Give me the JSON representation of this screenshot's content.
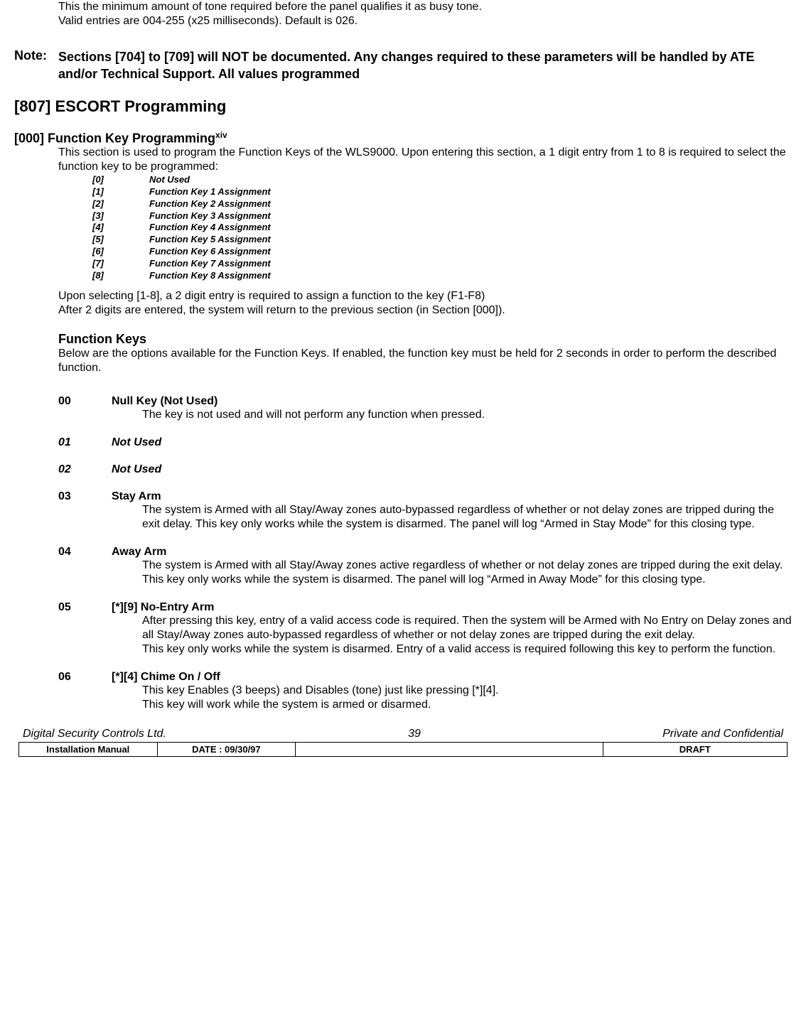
{
  "top": {
    "line1": "This the minimum amount of tone required before the panel qualifies it as busy tone.",
    "line2": "Valid entries are 004-255 (x25 milliseconds).  Default is 026."
  },
  "note": {
    "label": "Note:",
    "body": "Sections [704] to [709] will NOT be documented.  Any changes required to these parameters will be handled by ATE and/or Technical Support.  All values programmed"
  },
  "sec807": {
    "title": "[807] ESCORT Programming"
  },
  "sec000": {
    "title_prefix": "[000] Function Key Programming",
    "title_sup": "xiv",
    "intro": "This section is used to program the Function Keys of the WLS9000.  Upon entering this section, a 1 digit entry from 1 to 8 is required to select the function key to be programmed:",
    "table": [
      {
        "k": "[0]",
        "v": "Not Used"
      },
      {
        "k": "[1]",
        "v": "Function Key 1 Assignment"
      },
      {
        "k": "[2]",
        "v": "Function Key 2 Assignment"
      },
      {
        "k": "[3]",
        "v": "Function Key 3 Assignment"
      },
      {
        "k": "[4]",
        "v": "Function Key 4 Assignment"
      },
      {
        "k": "[5]",
        "v": "Function Key 5 Assignment"
      },
      {
        "k": "[6]",
        "v": "Function Key 6 Assignment"
      },
      {
        "k": "[7]",
        "v": "Function Key 7 Assignment"
      },
      {
        "k": "[8]",
        "v": "Function Key 8 Assignment"
      }
    ],
    "after1": "Upon selecting [1-8], a 2 digit entry is required to assign a function to the key (F1-F8)",
    "after2": "After 2 digits are entered, the system will return to the previous section (in Section [000]).",
    "fk_heading": "Function Keys",
    "fk_intro": "Below are the options available for the Function Keys.  If enabled, the function key must be held for 2 seconds in order to perform the described function."
  },
  "fn": {
    "f00": {
      "code": "00",
      "title": "Null Key (Not Used)",
      "desc": "The key is not used and will not perform any function when pressed."
    },
    "f01": {
      "code": "01",
      "title": "Not Used"
    },
    "f02": {
      "code": "02",
      "title": "Not Used"
    },
    "f03": {
      "code": "03",
      "title": "Stay Arm",
      "desc": "The system is Armed with all Stay/Away zones auto-bypassed regardless of whether or not delay zones are tripped during the exit delay.  This key only works while the system is disarmed. The panel will log “Armed in Stay Mode” for this closing type."
    },
    "f04": {
      "code": "04",
      "title": "Away Arm",
      "desc": "The system is Armed with all Stay/Away zones active regardless of whether or not delay zones are tripped during the exit delay.  This key only works while the system is disarmed. The panel will log “Armed in Away Mode” for this closing type."
    },
    "f05": {
      "code": "05",
      "title": "[*][9] No-Entry Arm",
      "d1": "After pressing this key, entry of a valid access code is required.  Then the system will be Armed with No Entry on Delay zones and all Stay/Away zones auto-bypassed regardless of whether or not delay zones are tripped during the exit delay.",
      "d2": "This key only works while the system is disarmed.  Entry of a valid access is required following this key to perform the function."
    },
    "f06": {
      "code": "06",
      "title": "[*][4] Chime On / Off",
      "d1": "This key Enables (3 beeps) and Disables (tone) just like pressing [*][4].",
      "d2": "This key will work while the system is armed or disarmed."
    }
  },
  "footer": {
    "left": "Digital Security Controls Ltd.",
    "center": "39",
    "right": "Private and Confidential",
    "cell1": "Installation Manual",
    "cell2": "DATE :  09/30/97",
    "cell3": "",
    "cell4": "DRAFT"
  }
}
